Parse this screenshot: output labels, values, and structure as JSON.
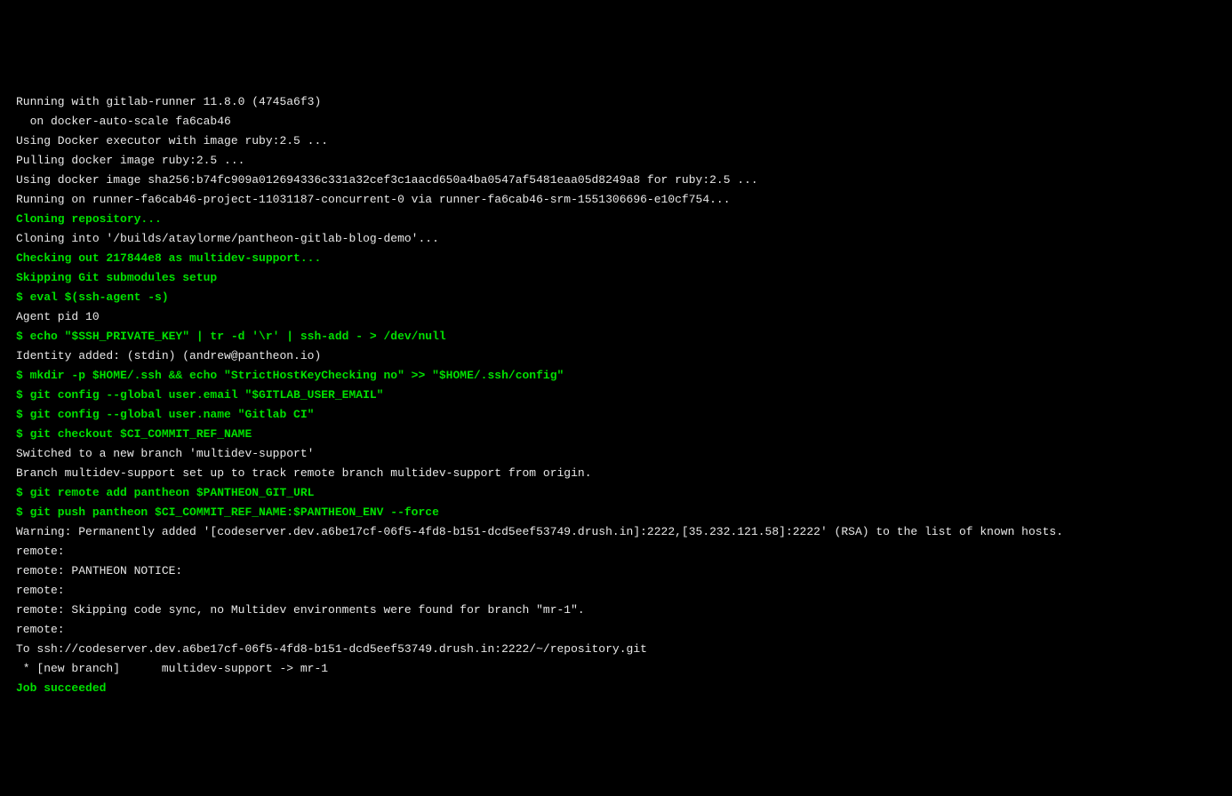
{
  "terminal": {
    "lines": [
      {
        "kind": "white",
        "text": "Running with gitlab-runner 11.8.0 (4745a6f3)"
      },
      {
        "kind": "white",
        "text": "  on docker-auto-scale fa6cab46"
      },
      {
        "kind": "white",
        "text": "Using Docker executor with image ruby:2.5 ..."
      },
      {
        "kind": "white",
        "text": "Pulling docker image ruby:2.5 ..."
      },
      {
        "kind": "white",
        "text": "Using docker image sha256:b74fc909a012694336c331a32cef3c1aacd650a4ba0547af5481eaa05d8249a8 for ruby:2.5 ..."
      },
      {
        "kind": "white",
        "text": "Running on runner-fa6cab46-project-11031187-concurrent-0 via runner-fa6cab46-srm-1551306696-e10cf754..."
      },
      {
        "kind": "green",
        "text": "Cloning repository..."
      },
      {
        "kind": "white",
        "text": "Cloning into '/builds/ataylorme/pantheon-gitlab-blog-demo'..."
      },
      {
        "kind": "green",
        "text": "Checking out 217844e8 as multidev-support..."
      },
      {
        "kind": "green",
        "text": "Skipping Git submodules setup"
      },
      {
        "kind": "green",
        "text": "$ eval $(ssh-agent -s)"
      },
      {
        "kind": "white",
        "text": "Agent pid 10"
      },
      {
        "kind": "green",
        "text": "$ echo \"$SSH_PRIVATE_KEY\" | tr -d '\\r' | ssh-add - > /dev/null"
      },
      {
        "kind": "white",
        "text": "Identity added: (stdin) (andrew@pantheon.io)"
      },
      {
        "kind": "green",
        "text": "$ mkdir -p $HOME/.ssh && echo \"StrictHostKeyChecking no\" >> \"$HOME/.ssh/config\""
      },
      {
        "kind": "green",
        "text": "$ git config --global user.email \"$GITLAB_USER_EMAIL\""
      },
      {
        "kind": "green",
        "text": "$ git config --global user.name \"Gitlab CI\""
      },
      {
        "kind": "green",
        "text": "$ git checkout $CI_COMMIT_REF_NAME"
      },
      {
        "kind": "white",
        "text": "Switched to a new branch 'multidev-support'"
      },
      {
        "kind": "white",
        "text": "Branch multidev-support set up to track remote branch multidev-support from origin."
      },
      {
        "kind": "green",
        "text": "$ git remote add pantheon $PANTHEON_GIT_URL"
      },
      {
        "kind": "green",
        "text": "$ git push pantheon $CI_COMMIT_REF_NAME:$PANTHEON_ENV --force"
      },
      {
        "kind": "white",
        "text": "Warning: Permanently added '[codeserver.dev.a6be17cf-06f5-4fd8-b151-dcd5eef53749.drush.in]:2222,[35.232.121.58]:2222' (RSA) to the list of known hosts."
      },
      {
        "kind": "white",
        "text": "remote: "
      },
      {
        "kind": "white",
        "text": "remote: PANTHEON NOTICE:"
      },
      {
        "kind": "white",
        "text": "remote: "
      },
      {
        "kind": "white",
        "text": "remote: Skipping code sync, no Multidev environments were found for branch \"mr-1\"."
      },
      {
        "kind": "white",
        "text": "remote: "
      },
      {
        "kind": "white",
        "text": "To ssh://codeserver.dev.a6be17cf-06f5-4fd8-b151-dcd5eef53749.drush.in:2222/~/repository.git"
      },
      {
        "kind": "white",
        "text": " * [new branch]      multidev-support -> mr-1"
      },
      {
        "kind": "green",
        "text": "Job succeeded"
      }
    ]
  }
}
